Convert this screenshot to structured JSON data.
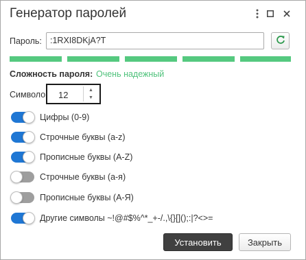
{
  "window": {
    "title": "Генератор паролей",
    "buttons": [
      "more-icon",
      "maximize-icon",
      "close-icon"
    ]
  },
  "password": {
    "label": "Пароль:",
    "value": ":1RXI8DKjA?T",
    "refresh_icon": "refresh-icon"
  },
  "strength": {
    "segments_filled": 5,
    "segments_total": 5,
    "color": "#55c97f",
    "label": "Сложность пароля:",
    "value": "Очень надежный"
  },
  "length": {
    "label": "Символов:",
    "value": "12"
  },
  "options": [
    {
      "label": "Цифры (0-9)",
      "enabled": true
    },
    {
      "label": "Строчные буквы (a-z)",
      "enabled": true
    },
    {
      "label": "Прописные буквы (A-Z)",
      "enabled": true
    },
    {
      "label": "Строчные буквы (а-я)",
      "enabled": false
    },
    {
      "label": "Прописные буквы (А-Я)",
      "enabled": false
    },
    {
      "label": "Другие символы ~!@#$%^*_+-/.,\\{}[]();:|?<>=",
      "enabled": true
    }
  ],
  "actions": {
    "submit": "Установить",
    "close": "Закрыть"
  },
  "colors": {
    "accent": "#1f77d4",
    "strength": "#55c97f",
    "primary_button": "#404040"
  }
}
